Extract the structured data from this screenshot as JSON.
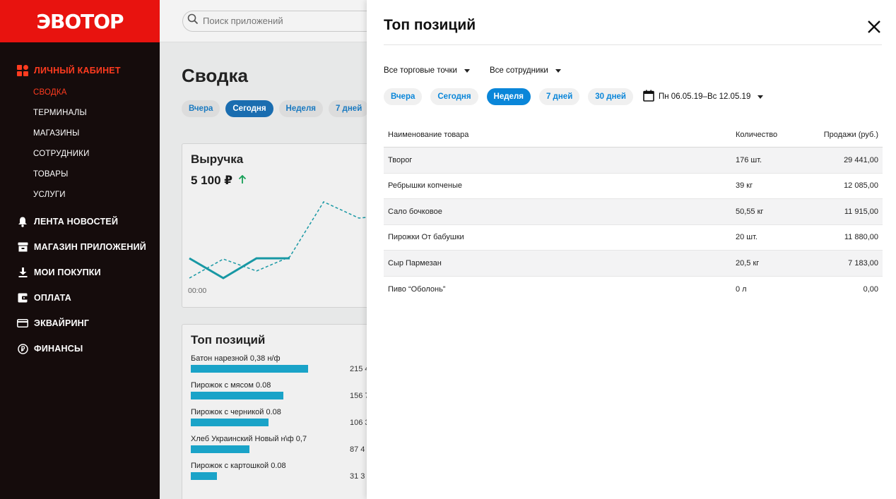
{
  "brand": {
    "logo": "ЭВОТОР",
    "accent": "#e8130f",
    "active_color": "#ff3b1f",
    "primary": "#0a86d9"
  },
  "sidebar": {
    "sections": [
      {
        "label": "ЛИЧНЫЙ КАБИНЕТ",
        "icon": "grid-icon",
        "active": true,
        "subitems": [
          {
            "label": "СВОДКА",
            "active": true
          },
          {
            "label": "ТЕРМИНАЛЫ"
          },
          {
            "label": "МАГАЗИНЫ"
          },
          {
            "label": "СОТРУДНИКИ"
          },
          {
            "label": "ТОВАРЫ"
          },
          {
            "label": "УСЛУГИ"
          }
        ]
      },
      {
        "label": "ЛЕНТА НОВОСТЕЙ",
        "icon": "bell-icon"
      },
      {
        "label": "МАГАЗИН ПРИЛОЖЕНИЙ",
        "icon": "store-icon"
      },
      {
        "label": "МОИ ПОКУПКИ",
        "icon": "download-icon"
      },
      {
        "label": "ОПЛАТА",
        "icon": "wallet-icon"
      },
      {
        "label": "ЭКВАЙРИНГ",
        "icon": "card-icon"
      },
      {
        "label": "ФИНАНСЫ",
        "icon": "ruble-icon"
      }
    ]
  },
  "search": {
    "placeholder": "Поиск приложений"
  },
  "main": {
    "title": "Сводка",
    "periods": [
      "Вчера",
      "Сегодня",
      "Неделя",
      "7 дней"
    ],
    "selected_period": "Сегодня",
    "revenue": {
      "title": "Выручка",
      "value": "5 100 ₽",
      "axis_start": "00:00"
    },
    "top": {
      "title": "Топ позиций",
      "items": [
        {
          "name": "Батон нарезной 0,38 н/ф",
          "value": "215 4",
          "fraction": 1.0
        },
        {
          "name": "Пирожок с мясом 0.08",
          "value": "156 7",
          "fraction": 0.79
        },
        {
          "name": "Пирожок с черникой 0.08",
          "value": "106 3",
          "fraction": 0.66
        },
        {
          "name": "Хлеб Украинский Новый н\\ф 0,7",
          "value": "87 4",
          "fraction": 0.5
        },
        {
          "name": "Пирожок с картошкой 0.08",
          "value": "31 3",
          "fraction": 0.22
        }
      ]
    }
  },
  "panel": {
    "title": "Топ позиций",
    "filters": {
      "stores": "Все торговые точки",
      "employees": "Все сотрудники"
    },
    "periods": [
      "Вчера",
      "Сегодня",
      "Неделя",
      "7 дней",
      "30 дней"
    ],
    "selected_period": "Неделя",
    "date_range": "Пн 06.05.19–Вс 12.05.19",
    "table": {
      "headers": [
        "Наименование товара",
        "Количество",
        "Продажи (руб.)"
      ],
      "rows": [
        [
          "Творог",
          "176 шт.",
          "29 441,00"
        ],
        [
          "Ребрышки копченые",
          "39 кг",
          "12 085,00"
        ],
        [
          "Сало бочковое",
          "50,55 кг",
          "11 915,00"
        ],
        [
          "Пирожки От бабушки",
          "20 шт.",
          "11 880,00"
        ],
        [
          "Сыр Пармезан",
          "20,5 кг",
          "7 183,00"
        ],
        [
          "Пиво “Оболонь”",
          "0 л",
          "0,00"
        ]
      ]
    }
  }
}
